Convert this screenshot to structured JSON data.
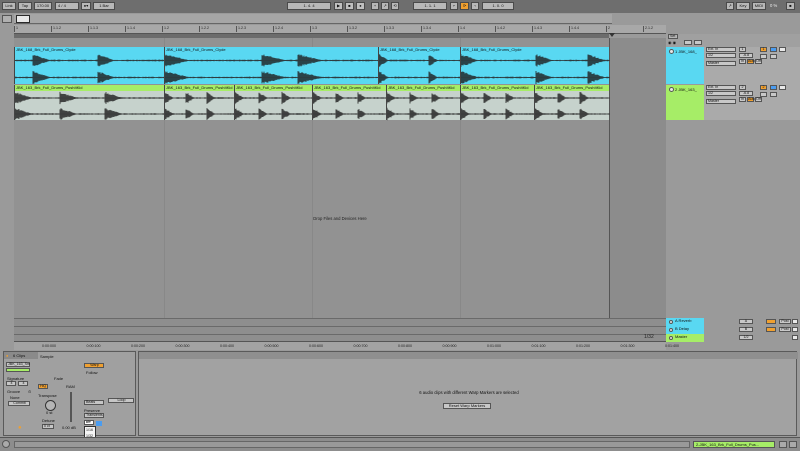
{
  "colors": {
    "clip_blue": "#59d8f2",
    "clip_green": "#a6ed67",
    "waveform": "#1e1e1e",
    "accent_orange": "#f0a030",
    "accent_blue": "#4a9cf0"
  },
  "transport": {
    "link": "Link",
    "tap": "Tap",
    "tempo": "170.00",
    "signature_num": "4",
    "signature_den": "4",
    "quantize": "1 Bar",
    "position": "1.  4.  4",
    "arrange_pos": "1.  1.  1",
    "loop_length": "1.  0.  0",
    "key": "Key",
    "midi": "MIDI",
    "cpu": "0 %"
  },
  "ruler": {
    "ticks": [
      "1",
      "1.1.2",
      "1.1.3",
      "1.1.4",
      "1.2",
      "1.2.2",
      "1.2.3",
      "1.2.4",
      "1.3",
      "1.3.2",
      "1.3.3",
      "1.3.4",
      "1.4",
      "1.4.2",
      "1.4.3",
      "1.4.4",
      "2",
      "2.1.2"
    ]
  },
  "tracks": [
    {
      "name": "1 JBK_168_",
      "input": "Ext. In",
      "sub_input": "1/2",
      "monitor_in": "In",
      "monitor_auto": "Auto",
      "monitor_off": "Off",
      "output": "Master",
      "volume": "-6.8",
      "num": "1",
      "clips": [
        "JBK_168_Brk_Full_Drums_Clyde",
        "JBK_168_Brk_Full_Drums_Clyde",
        "JBK_168_Brk_Full_Drums_Clyde",
        "JBK_168_Brk_Full_Drums_Clyde"
      ]
    },
    {
      "name": "2 JBK_163_",
      "input": "Ext. In",
      "sub_input": "1/2",
      "monitor_in": "In",
      "monitor_auto": "Auto",
      "monitor_off": "Off",
      "output": "Master",
      "volume": "-6.8",
      "num": "2",
      "clips": [
        "JBK_163_Brk_Full_Drums_PushItKid",
        "JBK_163_Brk_Full_Drums_PushItKid",
        "JBK_163_Brk_Full_Drums_PushItKid",
        "JBK_163_Brk_Full_Drums_PushItKid",
        "JBK_163_Brk_Full_Drums_PushItKid",
        "JBK_163_Brk_Full_Drums_PushItKid",
        "JBK_163_Brk_Full_Drums_PushItKid"
      ]
    }
  ],
  "drop_text": "Drop Files and Devices Here",
  "returns": [
    {
      "name": "A Reverb",
      "btn": "A",
      "post": "Post"
    },
    {
      "name": "B Delay",
      "btn": "B",
      "post": "Post"
    },
    {
      "name": "Master",
      "btn": "1/2"
    }
  ],
  "set_label": "Set",
  "zoom_fraction": "1/32",
  "bottom_ruler": [
    "0:00:000",
    "0:00:100",
    "0:00:200",
    "0:00:300",
    "0:00:400",
    "0:00:500",
    "0:00:600",
    "0:00:700",
    "0:00:800",
    "0:00:900",
    "0:01:000",
    "0:01:100",
    "0:01:200",
    "0:01:300",
    "0:01:400"
  ],
  "clip_view": {
    "clips_count": "6 Clips",
    "sample_title": "Sample",
    "clip_name": "JBK_163_Sm",
    "signature": "Signature",
    "sig_num": "4",
    "sig_den": "4",
    "groove": "Groove",
    "none": "None",
    "commit": "Commit",
    "hiq": "HiQ",
    "ram": "RAM",
    "gain": "Gain",
    "transpose": "Transpose",
    "transpose_val": "0 st",
    "detune": "Detune",
    "detune_val": "0 ct",
    "gain_val": "0.00 dB",
    "warp": "Warp",
    "warp_follow": "Follow",
    "warp_mode": "Beats",
    "preserve": "Preserve",
    "preserve_val": "Transients",
    "loop_btn": "Loop",
    "menu_items": [
      "1/16",
      "1/32",
      "1/8"
    ]
  },
  "detail": {
    "message": "6 audio clips with different Warp Markers are selected",
    "reset_button": "Reset Warp Markers"
  },
  "status": {
    "track_label": "2-JBK_163_Brk_Full_Drums_Pus..."
  }
}
